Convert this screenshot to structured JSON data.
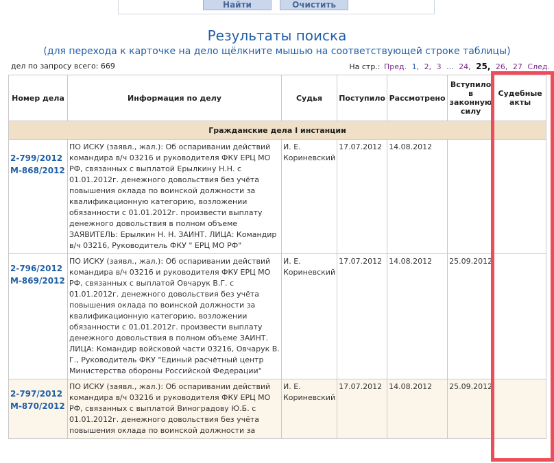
{
  "form": {
    "find_label": "Найти",
    "clear_label": "Очистить"
  },
  "header": {
    "title": "Результаты поиска",
    "subtitle": "(для перехода к карточке на дело щёлкните мышью на соответствующей строке таблицы)"
  },
  "found_text": "дел по запросу всего: 669",
  "pager": {
    "label": "На стр.:",
    "prev": "Пред.",
    "p1": "1,",
    "p2": "2,",
    "p3": "3",
    "dots": "...",
    "p24": "24,",
    "p25": "25,",
    "p26": "26,",
    "p27": "27",
    "next": "След."
  },
  "table": {
    "headers": {
      "number": "Номер дела",
      "info": "Информация по делу",
      "judge": "Судья",
      "received": "Поступило",
      "reviewed": "Рассмотрено",
      "in_force": "Вступило в законную силу",
      "acts": "Судебные акты"
    },
    "group_title": "Гражданские дела I инстанции",
    "rows": [
      {
        "num1": "2-799/2012",
        "num2": "М-868/2012",
        "info": "ПО ИСКУ (заявл., жал.): Об оспаривании действий командира в/ч 03216 и руководителя ФКУ ЕРЦ МО РФ, связанных с выплатой Ерылкину Н.Н. с 01.01.2012г. денежного довольствия без учёта повышения оклада по воинской должности за квалификационную категорию, возложении обязанности с 01.01.2012г. произвести выплату денежного довольствия в полном объеме ЗАЯВИТЕЛЬ: Ерылкин Н. Н. ЗАИНТ. ЛИЦА: Командир в/ч 03216, Руководитель ФКУ \" ЕРЦ МО РФ\"",
        "judge": "И. Е. Кориневский",
        "received": "17.07.2012",
        "reviewed": "14.08.2012",
        "in_force": "",
        "acts": ""
      },
      {
        "num1": "2-796/2012",
        "num2": "М-869/2012",
        "info": "ПО ИСКУ (заявл., жал.): Об оспаривании действий командира в/ч 03216 и руководителя ФКУ ЕРЦ МО РФ, связанных с выплатой Овчарук В.Г. с 01.01.2012г. денежного довольствия без учёта повышения оклада по воинской должности за квалификационную категорию, возложении обязанности с 01.01.2012г. произвести выплату денежного довольствия в полном объеме ЗАИНТ. ЛИЦА: Командир войсковой части 03216, Овчарук В. Г., Руководитель ФКУ \"Единый расчётный центр Министерства обороны Российской Федерации\"",
        "judge": "И. Е. Кориневский",
        "received": "17.07.2012",
        "reviewed": "14.08.2012",
        "in_force": "25.09.2012",
        "acts": ""
      },
      {
        "num1": "2-797/2012",
        "num2": "М-870/2012",
        "info": "ПО ИСКУ (заявл., жал.): Об оспаривании действий командира в/ч 03216 и руководителя ФКУ ЕРЦ МО РФ, связанных с выплатой Виноградову Ю.Б. с 01.01.2012г. денежного довольствия без учёта повышения оклада по воинской должности за",
        "judge": "И. Е. Кориневский",
        "received": "17.07.2012",
        "reviewed": "14.08.2012",
        "in_force": "25.09.2012",
        "acts": ""
      }
    ]
  },
  "colors": {
    "accent": "#1f5fa6",
    "group_bg": "#f0e0c8",
    "highlight": "#ee4c5a"
  }
}
